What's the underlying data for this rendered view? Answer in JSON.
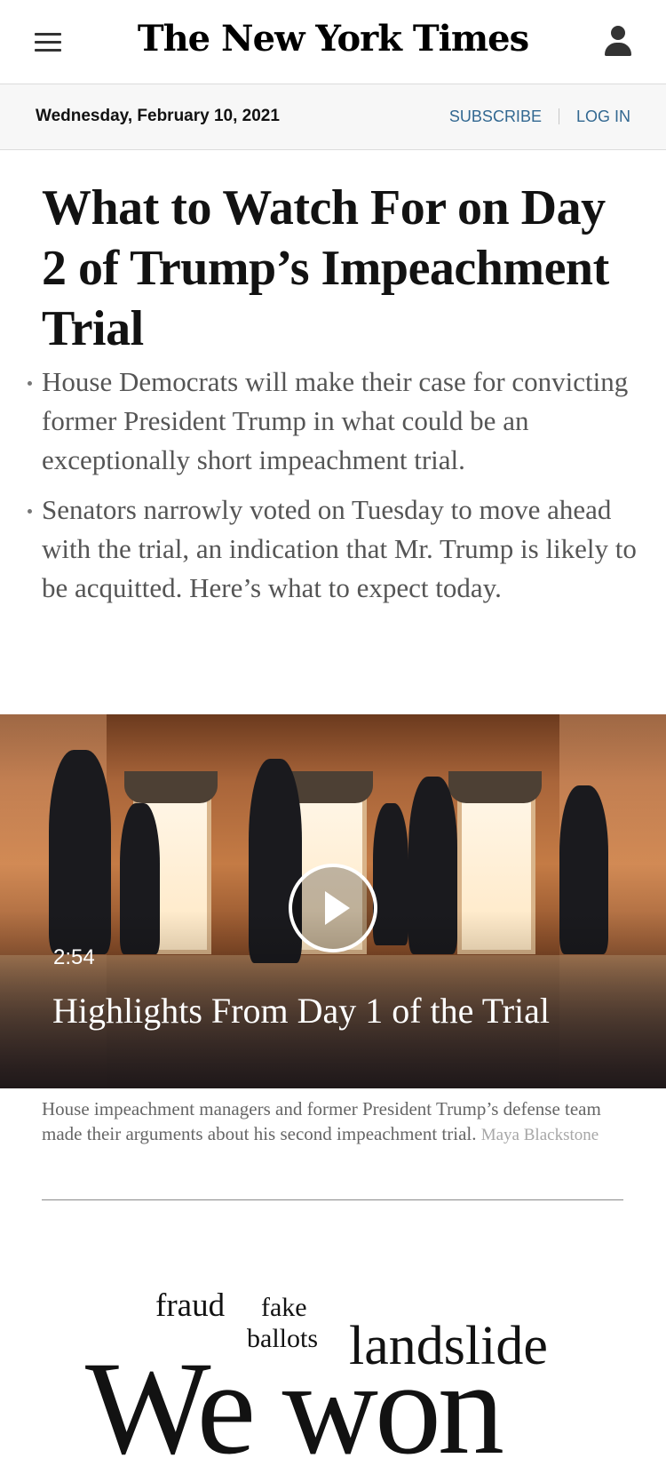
{
  "header": {
    "logo": "The New York Times",
    "date": "Wednesday, February 10, 2021",
    "subscribe": "SUBSCRIBE",
    "login": "LOG IN"
  },
  "article": {
    "headline": "What to Watch For on Day 2 of Trump’s Impeachment Trial",
    "bullets": [
      "House Democrats will make their case for convicting former President Trump in what could be an exceptionally short impeachment trial.",
      "Senators narrowly voted on Tuesday to move ahead with the trial, an indication that Mr. Trump is likely to be acquitted. Here’s what to expect today."
    ]
  },
  "video": {
    "duration": "2:54",
    "title": "Highlights From Day 1 of the Trial",
    "caption": "House impeachment managers and former President Trump’s defense team made their arguments about his second impeachment trial.",
    "credit": "Maya Blackstone"
  },
  "wordart": {
    "w1": "fraud",
    "w2": "fake",
    "w3": "ballots",
    "w4": "landslide",
    "w5": "We won"
  }
}
